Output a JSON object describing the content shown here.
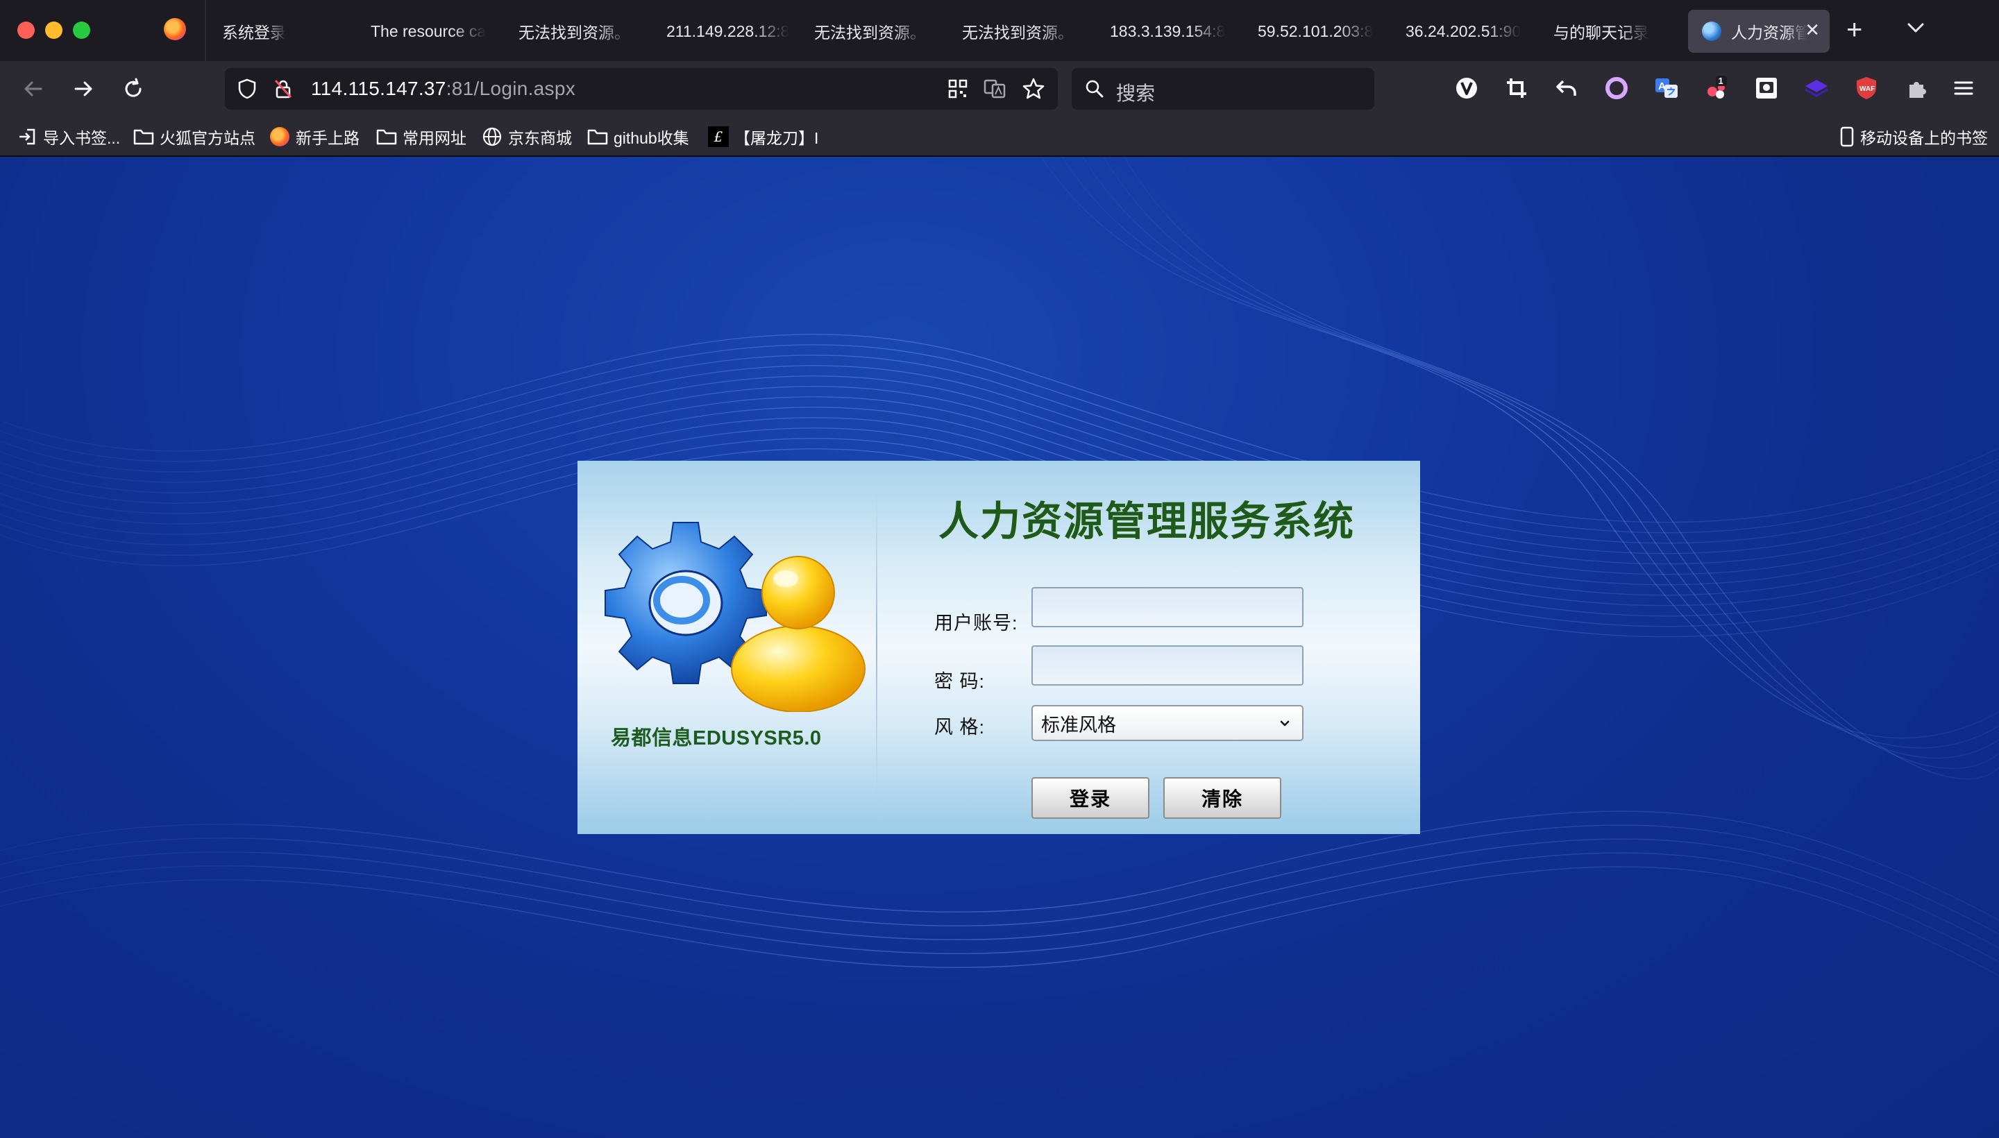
{
  "browser": {
    "tabs": [
      {
        "title": "系统登录",
        "active": false
      },
      {
        "title": "The resource ca",
        "active": false
      },
      {
        "title": "无法找到资源。",
        "active": false
      },
      {
        "title": "211.149.228.12:8",
        "active": false
      },
      {
        "title": "无法找到资源。",
        "active": false
      },
      {
        "title": "无法找到资源。",
        "active": false
      },
      {
        "title": "183.3.139.154:8",
        "active": false
      },
      {
        "title": "59.52.101.203:8",
        "active": false
      },
      {
        "title": "36.24.202.51:90",
        "active": false
      },
      {
        "title": "与的聊天记录",
        "active": false
      },
      {
        "title": "人力资源管",
        "active": true
      }
    ],
    "url": {
      "host": "114.115.147.37",
      "rest": ":81/Login.aspx"
    },
    "search_placeholder": "搜索",
    "extensions": [
      {
        "name": "vimium-icon",
        "badge": ""
      },
      {
        "name": "crop-icon",
        "badge": ""
      },
      {
        "name": "undo-icon",
        "badge": ""
      },
      {
        "name": "ring-icon",
        "badge": ""
      },
      {
        "name": "translate-icon",
        "badge": ""
      },
      {
        "name": "extension-red-icon",
        "badge": "1"
      },
      {
        "name": "screenshot-icon",
        "badge": ""
      },
      {
        "name": "layers-icon",
        "badge": ""
      },
      {
        "name": "waf-shield-icon",
        "badge": ""
      },
      {
        "name": "puzzle-icon",
        "badge": ""
      }
    ],
    "bookmarks": [
      {
        "label": "导入书签...",
        "icon": "import-icon"
      },
      {
        "label": "火狐官方站点",
        "icon": "folder-icon"
      },
      {
        "label": "新手上路",
        "icon": "firefox-icon"
      },
      {
        "label": "常用网址",
        "icon": "folder-icon"
      },
      {
        "label": "京东商城",
        "icon": "globe-icon"
      },
      {
        "label": "github收集",
        "icon": "folder-icon"
      },
      {
        "label": "【屠龙刀】I",
        "icon": "sword-icon"
      }
    ],
    "mobile_bookmarks": "移动设备上的书签"
  },
  "login": {
    "system_title": "人力资源管理服务系统",
    "brand": "易都信息EDUSYSR5.0",
    "username_label": "用户账号:",
    "username_value": "",
    "password_label": "密  码:",
    "password_value": "",
    "style_label": "风  格:",
    "style_selected": "标准风格",
    "login_button": "登录",
    "clear_button": "清除"
  },
  "colors": {
    "page_bg": "#1237a0",
    "title_green": "#1e5a1e",
    "chrome_bg": "#1c1b22",
    "toolbar_bg": "#2b2a33"
  }
}
